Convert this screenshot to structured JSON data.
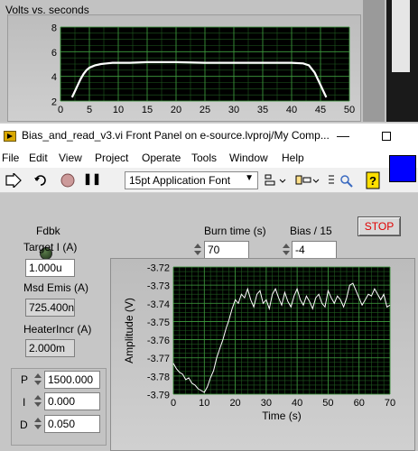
{
  "background_window": {
    "graph_title": "Volts vs. seconds",
    "chart_data": {
      "type": "line",
      "xlabel": "",
      "ylabel": "",
      "xlim": [
        0,
        50
      ],
      "ylim": [
        2,
        8
      ],
      "x_ticks": [
        "0",
        "5",
        "10",
        "15",
        "20",
        "25",
        "30",
        "35",
        "40",
        "45",
        "50"
      ],
      "y_ticks": [
        "2",
        "4",
        "6",
        "8"
      ],
      "grid": true,
      "series": [
        {
          "color": "#ffffff",
          "x": [
            2.0,
            2.5,
            3,
            3.5,
            4,
            4.5,
            5,
            5.5,
            6,
            7,
            8,
            9,
            10,
            12,
            15,
            20,
            25,
            30,
            35,
            40,
            42,
            43,
            44,
            44.5,
            45,
            45.5,
            46
          ],
          "y": [
            2.3,
            2.8,
            3.3,
            3.8,
            4.2,
            4.5,
            4.7,
            4.8,
            4.9,
            5.0,
            5.05,
            5.1,
            5.1,
            5.1,
            5.15,
            5.15,
            5.1,
            5.1,
            5.1,
            5.1,
            5.05,
            4.9,
            4.3,
            3.8,
            3.3,
            2.8,
            2.3
          ]
        }
      ]
    }
  },
  "window": {
    "title": "Bias_and_read_v3.vi Front Panel on e-source.lvproj/My Comp...",
    "minimize_glyph": "—",
    "menu": [
      "File",
      "Edit",
      "View",
      "Project",
      "Operate",
      "Tools",
      "Window",
      "Help"
    ],
    "toolbar": {
      "run_icon": "run-arrow-icon",
      "font": "15pt Application Font",
      "pause_glyph": "❚❚",
      "help_glyph": "?"
    },
    "accent_color": "#0000ff"
  },
  "panel": {
    "fdbk_label": "Fdbk",
    "burn_time_label": "Burn time (s)",
    "burn_time_value": "70",
    "bias_label": "Bias / 15",
    "bias_value": "-4",
    "stop_label": "STOP",
    "target_label": "Target I (A)",
    "target_value": "1.000u",
    "msd_label": "Msd Emis (A)",
    "msd_value": "725.400n",
    "heater_label": "HeaterIncr (A)",
    "heater_value": "2.000m",
    "p_label": "P",
    "p_value": "1500.000",
    "i_label": "I",
    "i_value": "0.000",
    "d_label": "D",
    "d_value": "0.050"
  },
  "chart_data": {
    "type": "line",
    "xlabel": "Time (s)",
    "ylabel": "Amplitude (V)",
    "xlim": [
      0,
      70
    ],
    "ylim": [
      -3.79,
      -3.72
    ],
    "x_ticks": [
      "0",
      "10",
      "20",
      "30",
      "40",
      "50",
      "60",
      "70"
    ],
    "y_ticks": [
      "-3.72",
      "-3.73",
      "-3.74",
      "-3.75",
      "-3.76",
      "-3.77",
      "-3.78",
      "-3.79"
    ],
    "grid": true,
    "series": [
      {
        "color": "#ffffff",
        "x": [
          0,
          1,
          2,
          3,
          4,
          5,
          6,
          7,
          8,
          9,
          10,
          11,
          12,
          13,
          14,
          15,
          16,
          17,
          18,
          19,
          20,
          21,
          22,
          23,
          24,
          25,
          26,
          27,
          28,
          29,
          30,
          31,
          32,
          33,
          34,
          35,
          36,
          37,
          38,
          39,
          40,
          41,
          42,
          43,
          44,
          45,
          46,
          47,
          48,
          49,
          50,
          51,
          52,
          53,
          54,
          55,
          56,
          57,
          58,
          59,
          60,
          61,
          62,
          63,
          64,
          65,
          66,
          67,
          68,
          69,
          70
        ],
        "y": [
          -3.773,
          -3.776,
          -3.778,
          -3.779,
          -3.782,
          -3.781,
          -3.784,
          -3.785,
          -3.787,
          -3.788,
          -3.789,
          -3.786,
          -3.781,
          -3.777,
          -3.77,
          -3.765,
          -3.76,
          -3.754,
          -3.749,
          -3.743,
          -3.738,
          -3.74,
          -3.735,
          -3.737,
          -3.732,
          -3.738,
          -3.742,
          -3.735,
          -3.733,
          -3.74,
          -3.738,
          -3.743,
          -3.735,
          -3.732,
          -3.737,
          -3.741,
          -3.734,
          -3.739,
          -3.742,
          -3.736,
          -3.732,
          -3.738,
          -3.741,
          -3.736,
          -3.739,
          -3.743,
          -3.737,
          -3.735,
          -3.74,
          -3.742,
          -3.733,
          -3.737,
          -3.74,
          -3.736,
          -3.738,
          -3.742,
          -3.737,
          -3.73,
          -3.729,
          -3.733,
          -3.737,
          -3.741,
          -3.738,
          -3.735,
          -3.736,
          -3.732,
          -3.735,
          -3.738,
          -3.735,
          -3.742,
          -3.741
        ]
      }
    ]
  }
}
